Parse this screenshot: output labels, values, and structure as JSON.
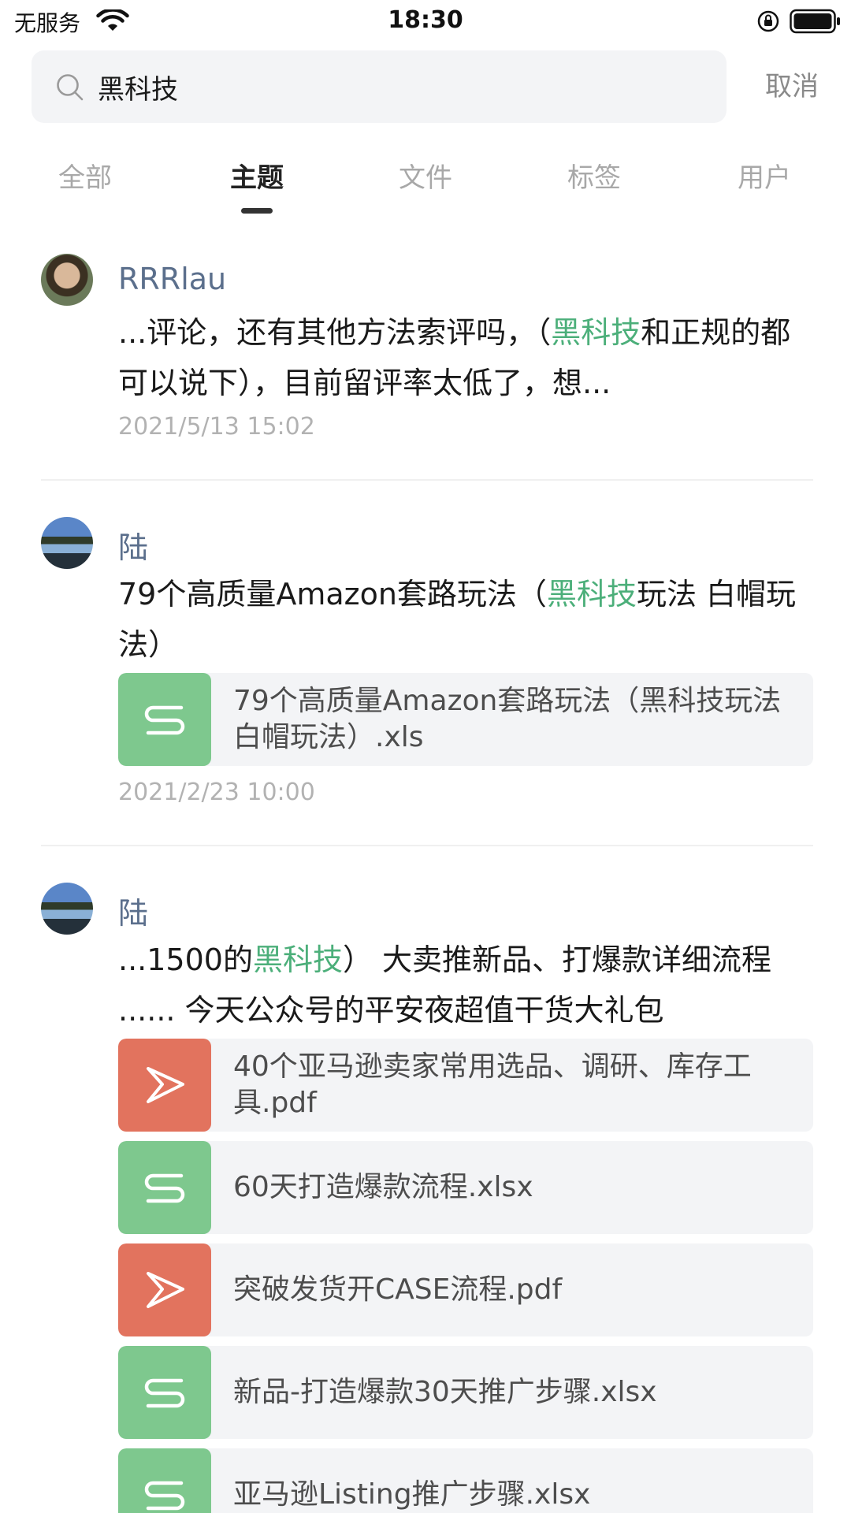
{
  "status_bar": {
    "carrier": "无服务",
    "time": "18:30"
  },
  "search": {
    "query": "黑科技",
    "cancel_label": "取消"
  },
  "tabs": [
    {
      "label": "全部",
      "active": false
    },
    {
      "label": "主题",
      "active": true
    },
    {
      "label": "文件",
      "active": false
    },
    {
      "label": "标签",
      "active": false
    },
    {
      "label": "用户",
      "active": false
    }
  ],
  "results": [
    {
      "username": "RRRlau",
      "content": [
        "...评论，还有其他方法索评吗，（",
        "黑科技",
        "和正规的都可以说下），目前留评率太低了，想..."
      ],
      "timestamp": "2021/5/13 15:02"
    },
    {
      "username": "陆",
      "content": [
        "79个高质量Amazon套路玩法（",
        "黑科技",
        "玩法 白帽玩法）"
      ],
      "attachments": [
        {
          "type": "sheet",
          "icon": "sheet-icon",
          "name": "79个高质量Amazon套路玩法（黑科技玩法 白帽玩法）.xls"
        }
      ],
      "timestamp": "2021/2/23 10:00"
    },
    {
      "username": "陆",
      "content": [
        "...1500的",
        "黑科技",
        "）  大卖推新品、打爆款详细流程  ......  今天公众号的平安夜超值干货大礼包"
      ],
      "attachments": [
        {
          "type": "pdf",
          "icon": "pdf-icon",
          "name": "40个亚马逊卖家常用选品、调研、库存工具.pdf"
        },
        {
          "type": "sheet",
          "icon": "sheet-icon",
          "name": "60天打造爆款流程.xlsx"
        },
        {
          "type": "pdf",
          "icon": "pdf-icon",
          "name": "突破发货开CASE流程.pdf"
        },
        {
          "type": "sheet",
          "icon": "sheet-icon",
          "name": "新品-打造爆款30天推广步骤.xlsx"
        },
        {
          "type": "sheet",
          "icon": "sheet-icon",
          "name": "亚马逊Listing推广步骤.xlsx"
        }
      ]
    }
  ],
  "colors": {
    "highlight": "#4caf7a",
    "username": "#5b6f8c",
    "sheet": "#7ec88e",
    "pdf": "#e2735e"
  }
}
